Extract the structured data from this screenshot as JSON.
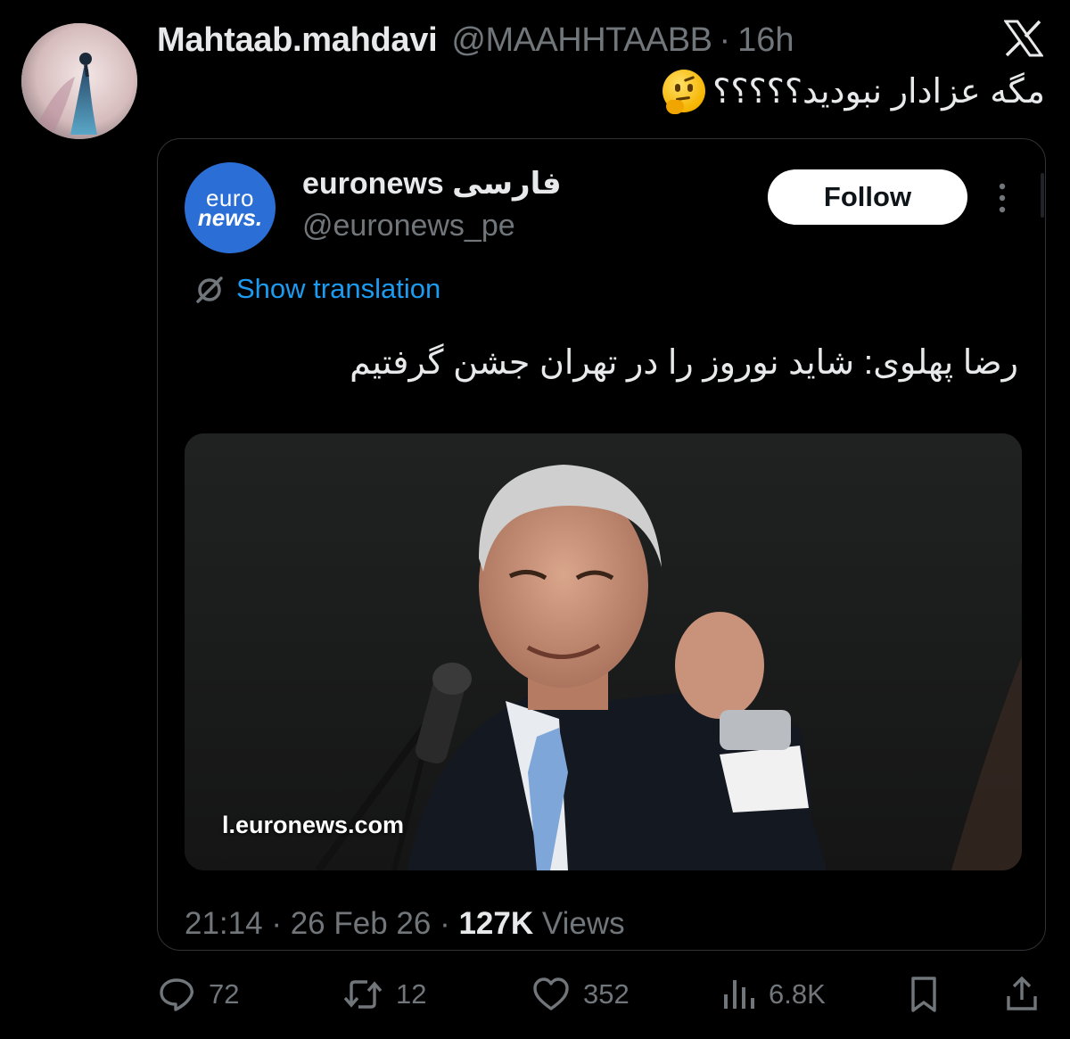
{
  "tweet": {
    "display_name": "Mahtaab.mahdavi",
    "handle": "@MAAHHTAABB",
    "separator": "·",
    "time": "16h",
    "text": "مگه عزادار نبودید؟؟؟؟؟"
  },
  "quoted": {
    "avatar_line1": "euro",
    "avatar_line2": "news.",
    "name": "euronews فارسی",
    "handle": "@euronews_pe",
    "follow_label": "Follow",
    "show_translation": "Show translation",
    "text": "رضا پهلوی: شاید نوروز را در تهران جشن گرفتیم",
    "media_url": "l.euronews.com",
    "time": "21:14",
    "date": "26 Feb 26",
    "views_count": "127K",
    "views_label": "Views"
  },
  "actions": {
    "replies": "72",
    "reposts": "12",
    "likes": "352",
    "views": "6.8K"
  },
  "colors": {
    "background": "#000000",
    "text": "#e7e9ea",
    "muted": "#71767b",
    "link": "#1d9bf0",
    "border": "#2f3336",
    "euronews_blue": "#2b6fd6"
  },
  "icons": [
    "x-logo-icon",
    "thinking-face-icon",
    "more-icon",
    "translate-icon",
    "reply-icon",
    "repost-icon",
    "like-icon",
    "views-icon",
    "bookmark-icon",
    "share-icon"
  ]
}
